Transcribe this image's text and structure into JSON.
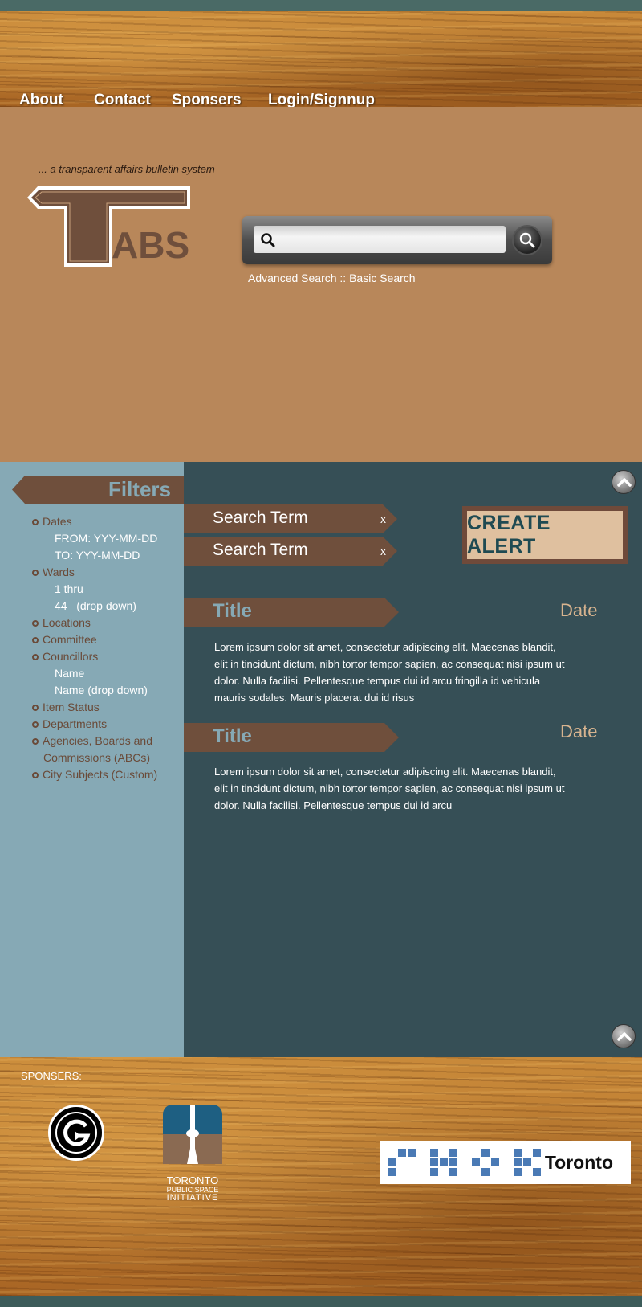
{
  "nav": {
    "items": [
      {
        "label": "About"
      },
      {
        "label": "Contact"
      },
      {
        "label": "Sponsers"
      },
      {
        "label": "Login/Signnup"
      }
    ]
  },
  "hero": {
    "tagline": "... a transparent affairs bulletin system",
    "logo_text": "ABS",
    "search_placeholder": "",
    "advanced_search": "Advanced Search",
    "separator": "::",
    "basic_search": "Basic Search"
  },
  "sidebar": {
    "title": "Filters",
    "dates": "Dates",
    "from": "FROM: YYY-MM-DD",
    "to": "TO: YYY-MM-DD",
    "wards": "Wards",
    "wards_1": "1 thru",
    "wards_2": "44   (drop down)",
    "locations": "Locations",
    "committee": "Committee",
    "councillors": "Councillors",
    "councillors_1": "Name",
    "councillors_2": "Name (drop down)",
    "item_status": "Item Status",
    "departments": "Departments",
    "abcs_1": "Agencies, Boards and",
    "abcs_2": "Commissions (ABCs)",
    "city_subjects": "City Subjects (Custom)"
  },
  "main": {
    "search_terms": [
      {
        "label": "Search Term",
        "remove": "x"
      },
      {
        "label": "Search Term",
        "remove": "x"
      }
    ],
    "create_alert": "CREATE ALERT",
    "results": [
      {
        "title": "Title",
        "date": "Date",
        "body": "Lorem ipsum dolor sit amet, consectetur adipiscing elit. Maecenas blandit, elit in tincidunt dictum, nibh tortor tempor sapien, ac consequat nisi ipsum ut dolor. Nulla facilisi. Pellentesque tempus dui id arcu fringilla id vehicula mauris sodales. Mauris placerat dui id risus"
      },
      {
        "title": "Title",
        "date": "Date",
        "body": "Lorem ipsum dolor sit amet, consectetur adipiscing elit. Maecenas blandit, elit in tincidunt dictum, nibh tortor tempor sapien, ac consequat nisi ipsum ut dolor. Nulla facilisi. Pellentesque tempus dui id arcu"
      }
    ]
  },
  "footer": {
    "sponsers_label": "SPONSERS:",
    "tpsi_1": "TORONTO",
    "tpsi_2": "PUBLIC SPACE",
    "tpsi_3": "INITIATIVE",
    "hack_city": "Toronto"
  },
  "colors": {
    "hero_bg": "#b8875a",
    "sidebar_bg": "#86a9b5",
    "main_bg": "#364f56",
    "banner_brown": "#6f4f3c",
    "alert_inner": "#dfc09f"
  }
}
